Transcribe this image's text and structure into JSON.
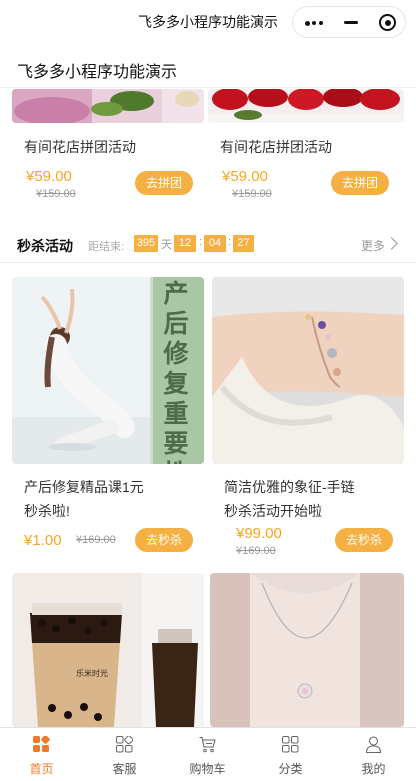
{
  "window": {
    "title": "飞多多小程序功能演示"
  },
  "page": {
    "heading": "飞多多小程序功能演示"
  },
  "group_buy": {
    "items": [
      {
        "title": "有间花店拼团活动",
        "price": "¥59.00",
        "old_price": "¥159.00",
        "button": "去拼团"
      },
      {
        "title": "有间花店拼团活动",
        "price": "¥59.00",
        "old_price": "¥159.00",
        "button": "去拼团"
      }
    ]
  },
  "flash_sale": {
    "title": "秒杀活动",
    "countdown_label": "距结束:",
    "days": "395",
    "days_unit": "天",
    "hours": "12",
    "minutes": "04",
    "seconds": "27",
    "more": "更多",
    "items": [
      {
        "title_line1": "产后修复精品课1元",
        "title_line2": "秒杀啦!",
        "price": "¥1.00",
        "old_price": "¥169.00",
        "button": "去秒杀",
        "image_text": "产后修复重要性"
      },
      {
        "title_line1": "简洁优雅的象征-手链",
        "title_line2": "秒杀活动开始啦",
        "price": "¥99.00",
        "old_price": "¥169.00",
        "button": "去秒杀"
      },
      {
        "image_text": "乐米时光"
      }
    ]
  },
  "tabbar": {
    "tabs": [
      {
        "label": "首页",
        "icon": "home-grid-icon",
        "active": true
      },
      {
        "label": "客服",
        "icon": "service-icon",
        "active": false
      },
      {
        "label": "购物车",
        "icon": "cart-icon",
        "active": false
      },
      {
        "label": "分类",
        "icon": "category-icon",
        "active": false
      },
      {
        "label": "我的",
        "icon": "user-icon",
        "active": false
      }
    ]
  },
  "colors": {
    "accent": "#f5b043",
    "price": "#f5a623",
    "tab_active": "#f07a2c"
  }
}
